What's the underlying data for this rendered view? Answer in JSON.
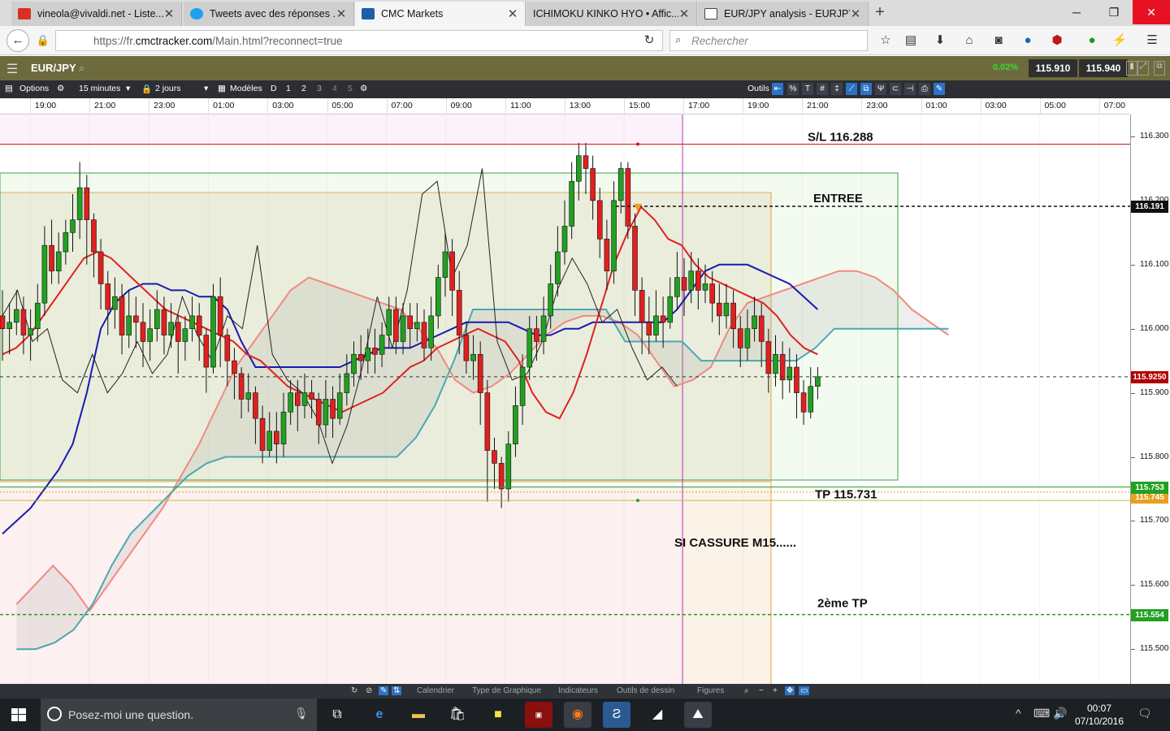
{
  "browser": {
    "tabs": [
      {
        "title": "vineola@vivaldi.net - Liste...",
        "icon_color": "#d93025",
        "icon": "mail-icon",
        "active": false
      },
      {
        "title": "Tweets avec des réponses ...",
        "icon_color": "#1da1f2",
        "icon": "twitter-icon",
        "active": false
      },
      {
        "title": "CMC Markets",
        "icon_color": "#1b5fa8",
        "icon": "cmc-icon",
        "active": true
      },
      {
        "title": "ICHIMOKU KINKO HYO • Affic...",
        "icon_color": "",
        "icon": "",
        "active": false
      },
      {
        "title": "EUR/JPY analysis - EURJPY...",
        "icon_color": "#444444",
        "icon": "doc-icon",
        "active": false
      }
    ],
    "url_prefix": "https://fr.",
    "url_domain": "cmctracker.com",
    "url_path": "/Main.html?reconnect=true",
    "search_placeholder": "Rechercher"
  },
  "app": {
    "symbol": "EUR/JPY",
    "change_pct": "0.02%",
    "sell_price": "115.910",
    "buy_price": "115.940"
  },
  "chart_toolbar": {
    "options_label": "Options",
    "interval": "15 minutes",
    "range": "2 jours",
    "models_label": "Modèles",
    "views": [
      "D",
      "1",
      "2",
      "3",
      "4",
      "5"
    ],
    "tools_label": "Outils"
  },
  "time_axis": [
    "19:00",
    "21:00",
    "23:00",
    "01:00",
    "03:00",
    "05:00",
    "07:00",
    "09:00",
    "11:00",
    "13:00",
    "15:00",
    "17:00",
    "19:00",
    "21:00",
    "23:00",
    "01:00",
    "03:00",
    "05:00",
    "07:00"
  ],
  "price_axis": [
    "116.300",
    "116.200",
    "116.100",
    "116.000",
    "115.900",
    "115.800",
    "115.700",
    "115.600",
    "115.500"
  ],
  "tags": {
    "entry_price": "116.191",
    "current_price": "115.9250",
    "tp_price": "115.753",
    "tp_price_2": "115.745",
    "tp2_price": "115.554"
  },
  "annotations": {
    "sl": "S/L 116.288",
    "entry": "ENTREE",
    "tp": "TP 115.731",
    "breakout": "SI CASSURE M15......",
    "tp2": "2ème TP"
  },
  "bottom_bar": [
    "Calendrier",
    "Type de Graphique",
    "Indicateurs",
    "Outils de dessin",
    "Figures"
  ],
  "taskbar": {
    "search_placeholder": "Posez-moi une question.",
    "time": "00:07",
    "date": "07/10/2016"
  },
  "colors": {
    "up": "#22a022",
    "down": "#e02020",
    "tenkan": "#e02020",
    "kijun": "#1a1ab0",
    "senkou_a": "#f08a80",
    "senkou_b": "#4aa8b0",
    "chikou": "#222222",
    "sl_line": "#d01818",
    "tp_line": "#22a022"
  },
  "chart_data": {
    "type": "candlestick",
    "ylim": [
      115.45,
      116.34
    ],
    "levels": {
      "sl": 116.288,
      "entry": 116.191,
      "current": 115.925,
      "tp": 115.753,
      "tp2": 115.554
    },
    "candles": [
      [
        116.02,
        116.0,
        116.06,
        115.95
      ],
      [
        116.0,
        116.01,
        116.04,
        115.96
      ],
      [
        116.01,
        116.03,
        116.06,
        115.99
      ],
      [
        116.03,
        115.99,
        116.05,
        115.96
      ],
      [
        115.99,
        116.0,
        116.03,
        115.95
      ],
      [
        116.0,
        116.04,
        116.07,
        115.98
      ],
      [
        116.04,
        116.13,
        116.16,
        116.02
      ],
      [
        116.13,
        116.09,
        116.17,
        116.07
      ],
      [
        116.09,
        116.12,
        116.15,
        116.07
      ],
      [
        116.12,
        116.15,
        116.17,
        116.1
      ],
      [
        116.15,
        116.17,
        116.21,
        116.12
      ],
      [
        116.17,
        116.22,
        116.26,
        116.14
      ],
      [
        116.22,
        116.17,
        116.24,
        116.1
      ],
      [
        116.17,
        116.12,
        116.18,
        116.08
      ],
      [
        116.12,
        116.07,
        116.14,
        116.03
      ],
      [
        116.07,
        116.03,
        116.09,
        115.99
      ],
      [
        116.03,
        116.05,
        116.08,
        116.0
      ],
      [
        116.05,
        115.99,
        116.07,
        115.96
      ],
      [
        115.99,
        116.02,
        116.06,
        115.97
      ],
      [
        116.02,
        116.01,
        116.05,
        115.97
      ],
      [
        116.01,
        115.98,
        116.04,
        115.94
      ],
      [
        115.98,
        116.0,
        116.03,
        115.95
      ],
      [
        116.0,
        116.03,
        116.06,
        115.98
      ],
      [
        116.03,
        115.99,
        116.05,
        115.96
      ],
      [
        115.99,
        116.01,
        116.04,
        115.97
      ],
      [
        116.01,
        115.98,
        116.02,
        115.93
      ],
      [
        115.98,
        116.0,
        116.02,
        115.95
      ],
      [
        116.0,
        116.02,
        116.05,
        115.98
      ],
      [
        116.02,
        115.99,
        116.04,
        115.95
      ],
      [
        115.99,
        115.94,
        116.0,
        115.9
      ],
      [
        115.94,
        116.05,
        116.07,
        115.93
      ],
      [
        116.05,
        115.99,
        116.08,
        115.94
      ],
      [
        115.99,
        115.95,
        116.0,
        115.91
      ],
      [
        115.95,
        115.93,
        115.97,
        115.89
      ],
      [
        115.93,
        115.89,
        115.94,
        115.86
      ],
      [
        115.89,
        115.9,
        115.93,
        115.87
      ],
      [
        115.9,
        115.86,
        115.91,
        115.82
      ],
      [
        115.86,
        115.81,
        115.88,
        115.79
      ],
      [
        115.81,
        115.84,
        115.87,
        115.8
      ],
      [
        115.84,
        115.82,
        115.87,
        115.79
      ],
      [
        115.82,
        115.87,
        115.9,
        115.8
      ],
      [
        115.87,
        115.9,
        115.92,
        115.85
      ],
      [
        115.9,
        115.88,
        115.92,
        115.84
      ],
      [
        115.88,
        115.9,
        115.93,
        115.86
      ],
      [
        115.9,
        115.89,
        115.92,
        115.86
      ],
      [
        115.89,
        115.85,
        115.9,
        115.82
      ],
      [
        115.85,
        115.89,
        115.92,
        115.83
      ],
      [
        115.89,
        115.86,
        115.91,
        115.83
      ],
      [
        115.86,
        115.9,
        115.93,
        115.85
      ],
      [
        115.9,
        115.93,
        115.96,
        115.88
      ],
      [
        115.93,
        115.96,
        115.98,
        115.91
      ],
      [
        115.96,
        115.95,
        115.99,
        115.92
      ],
      [
        115.95,
        115.97,
        116.0,
        115.93
      ],
      [
        115.97,
        115.96,
        116.0,
        115.93
      ],
      [
        115.96,
        115.99,
        116.01,
        115.94
      ],
      [
        115.99,
        116.03,
        116.05,
        115.97
      ],
      [
        116.03,
        115.98,
        116.05,
        115.96
      ],
      [
        115.98,
        116.02,
        116.04,
        115.96
      ],
      [
        116.02,
        116.0,
        116.04,
        115.97
      ],
      [
        116.0,
        116.01,
        116.04,
        115.98
      ],
      [
        116.01,
        115.97,
        116.03,
        115.95
      ],
      [
        115.97,
        116.02,
        116.05,
        115.95
      ],
      [
        116.02,
        116.08,
        116.1,
        116.0
      ],
      [
        116.08,
        116.12,
        116.15,
        116.05
      ],
      [
        116.12,
        116.06,
        116.14,
        116.02
      ],
      [
        116.06,
        115.99,
        116.09,
        115.96
      ],
      [
        115.99,
        115.95,
        116.01,
        115.93
      ],
      [
        115.95,
        115.96,
        115.99,
        115.92
      ],
      [
        115.96,
        115.9,
        115.98,
        115.85
      ],
      [
        115.9,
        115.81,
        115.92,
        115.73
      ],
      [
        115.81,
        115.79,
        115.83,
        115.75
      ],
      [
        115.79,
        115.75,
        115.8,
        115.72
      ],
      [
        115.75,
        115.82,
        115.84,
        115.73
      ],
      [
        115.82,
        115.88,
        115.91,
        115.8
      ],
      [
        115.88,
        115.94,
        115.96,
        115.85
      ],
      [
        115.94,
        116.0,
        116.02,
        115.92
      ],
      [
        116.0,
        115.98,
        116.02,
        115.95
      ],
      [
        115.98,
        116.02,
        116.05,
        115.96
      ],
      [
        116.02,
        116.07,
        116.1,
        116.0
      ],
      [
        116.07,
        116.12,
        116.16,
        116.05
      ],
      [
        116.12,
        116.16,
        116.2,
        116.1
      ],
      [
        116.16,
        116.23,
        116.26,
        116.14
      ],
      [
        116.23,
        116.27,
        116.29,
        116.2
      ],
      [
        116.27,
        116.25,
        116.29,
        116.21
      ],
      [
        116.25,
        116.2,
        116.27,
        116.17
      ],
      [
        116.2,
        116.14,
        116.22,
        116.11
      ],
      [
        116.14,
        116.09,
        116.17,
        116.06
      ],
      [
        116.09,
        116.2,
        116.23,
        116.07
      ],
      [
        116.2,
        116.25,
        116.26,
        116.18
      ],
      [
        116.25,
        116.16,
        116.26,
        116.14
      ],
      [
        116.16,
        116.06,
        116.18,
        116.02
      ],
      [
        116.06,
        116.01,
        116.08,
        115.96
      ],
      [
        116.01,
        115.99,
        116.05,
        115.96
      ],
      [
        115.99,
        116.02,
        116.06,
        115.98
      ],
      [
        116.02,
        116.01,
        116.05,
        115.97
      ],
      [
        116.01,
        116.05,
        116.08,
        116.0
      ],
      [
        116.05,
        116.08,
        116.12,
        116.03
      ],
      [
        116.08,
        116.06,
        116.11,
        116.02
      ],
      [
        116.06,
        116.09,
        116.12,
        116.04
      ],
      [
        116.09,
        116.06,
        116.11,
        116.03
      ],
      [
        116.06,
        116.07,
        116.1,
        116.04
      ],
      [
        116.07,
        116.04,
        116.09,
        116.01
      ],
      [
        116.04,
        116.02,
        116.07,
        115.99
      ],
      [
        116.02,
        116.04,
        116.07,
        116.0
      ],
      [
        116.04,
        116.0,
        116.06,
        115.97
      ],
      [
        116.0,
        115.97,
        116.02,
        115.94
      ],
      [
        115.97,
        116.0,
        116.03,
        115.95
      ],
      [
        116.0,
        116.02,
        116.05,
        115.98
      ],
      [
        116.02,
        115.98,
        116.04,
        115.94
      ],
      [
        115.98,
        115.93,
        116.0,
        115.9
      ],
      [
        115.93,
        115.96,
        115.99,
        115.91
      ],
      [
        115.96,
        115.92,
        115.98,
        115.89
      ],
      [
        115.92,
        115.94,
        115.97,
        115.9
      ],
      [
        115.94,
        115.9,
        115.96,
        115.86
      ],
      [
        115.9,
        115.87,
        115.92,
        115.85
      ],
      [
        115.87,
        115.91,
        115.94,
        115.86
      ],
      [
        115.91,
        115.925,
        115.94,
        115.89
      ]
    ],
    "tenkan": [
      115.96,
      115.97,
      115.99,
      116.02,
      116.05,
      116.08,
      116.11,
      116.12,
      116.11,
      116.09,
      116.07,
      116.05,
      116.03,
      116.02,
      116.01,
      116.0,
      115.99,
      115.98,
      115.96,
      115.95,
      115.93,
      115.91,
      115.9,
      115.89,
      115.88,
      115.87,
      115.88,
      115.89,
      115.9,
      115.92,
      115.94,
      115.95,
      115.97,
      115.98,
      115.99,
      116.0,
      115.99,
      115.98,
      115.95,
      115.9,
      115.87,
      115.86,
      115.9,
      115.96,
      116.03,
      116.1,
      116.15,
      116.19,
      116.17,
      116.14,
      116.13,
      116.1,
      116.08,
      116.07,
      116.06,
      116.05,
      116.04,
      116.02,
      115.99,
      115.97,
      115.96
    ],
    "kijun": [
      115.68,
      115.7,
      115.72,
      115.75,
      115.78,
      115.82,
      115.9,
      116.0,
      116.04,
      116.06,
      116.07,
      116.07,
      116.06,
      116.06,
      116.05,
      116.05,
      116.03,
      115.98,
      115.94,
      115.94,
      115.94,
      115.94,
      115.94,
      115.94,
      115.94,
      115.95,
      115.96,
      115.97,
      115.97,
      115.97,
      115.98,
      115.99,
      116.0,
      116.01,
      116.01,
      116.01,
      116.01,
      116.0,
      115.99,
      115.99,
      116.0,
      116.0,
      116.01,
      116.01,
      116.01,
      116.01,
      116.01,
      116.01,
      116.03,
      116.06,
      116.09,
      116.1,
      116.1,
      116.1,
      116.09,
      116.08,
      116.07,
      116.05,
      116.03
    ],
    "senkou_a": [
      115.57,
      115.6,
      115.63,
      115.6,
      115.56,
      115.6,
      115.64,
      115.68,
      115.72,
      115.77,
      115.82,
      115.88,
      115.94,
      115.98,
      116.02,
      116.06,
      116.08,
      116.07,
      116.06,
      116.05,
      116.04,
      116.03,
      116.0,
      115.97,
      115.92,
      115.9,
      115.91,
      115.93,
      115.96,
      115.99,
      116.01,
      116.02,
      116.02,
      116.01,
      115.99,
      115.95,
      115.91,
      115.92,
      115.94,
      116.0,
      116.04,
      116.05,
      116.06,
      116.07,
      116.08,
      116.09,
      116.09,
      116.08,
      116.06,
      116.03,
      116.01,
      115.99
    ],
    "senkou_b": [
      115.5,
      115.5,
      115.51,
      115.53,
      115.57,
      115.63,
      115.68,
      115.71,
      115.74,
      115.77,
      115.79,
      115.8,
      115.8,
      115.8,
      115.8,
      115.8,
      115.8,
      115.8,
      115.8,
      115.8,
      115.8,
      115.83,
      115.88,
      115.95,
      116.03,
      116.03,
      116.03,
      116.03,
      116.03,
      116.03,
      116.03,
      116.03,
      115.98,
      115.98,
      115.98,
      115.98,
      115.95,
      115.95,
      115.95,
      115.95,
      115.95,
      115.95,
      115.97,
      116.0,
      116.0,
      116.0,
      116.0,
      116.0,
      116.0,
      116.0
    ],
    "chikou": [
      116.02,
      116.06,
      115.98,
      116.0,
      115.92,
      115.9,
      115.96,
      115.9,
      115.93,
      115.98,
      115.93,
      115.96,
      116.05,
      115.99,
      115.95,
      116.02,
      116.0,
      116.13,
      115.96,
      115.92,
      115.9,
      115.86,
      115.79,
      115.85,
      115.94,
      116.05,
      115.97,
      116.06,
      116.21,
      116.23,
      116.08,
      116.13,
      116.25,
      115.98,
      115.92,
      115.93,
      115.98,
      116.06,
      116.11,
      116.07,
      116.01,
      116.03,
      115.97,
      115.92,
      115.94,
      115.91
    ]
  }
}
